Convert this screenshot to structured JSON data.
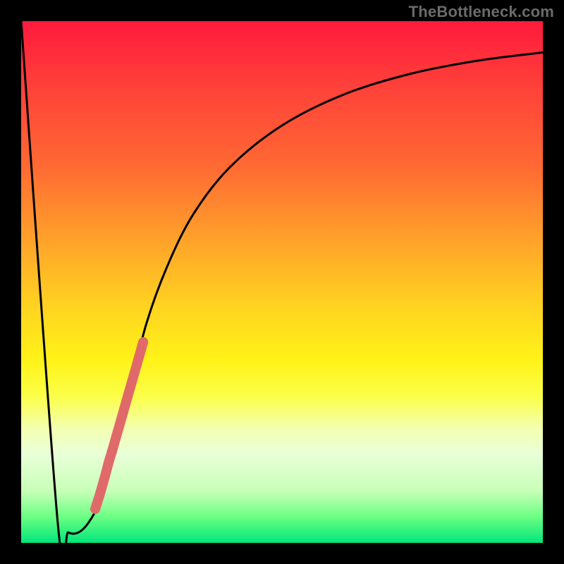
{
  "attribution": "TheBottleneck.com",
  "chart_data": {
    "type": "line",
    "title": "",
    "xlabel": "",
    "ylabel": "",
    "xlim": [
      0,
      100
    ],
    "ylim": [
      0,
      100
    ],
    "series": [
      {
        "name": "bottleneck-curve",
        "x": [
          0,
          7,
          9,
          11,
          13,
          15,
          18,
          21,
          24,
          28,
          33,
          40,
          50,
          62,
          75,
          88,
          100
        ],
        "y": [
          100,
          4,
          2,
          2,
          4,
          8,
          18,
          30,
          42,
          53,
          63,
          72,
          80,
          86,
          90,
          92.5,
          94
        ]
      }
    ],
    "markers": {
      "name": "highlighted-points",
      "color": "#e06a6a",
      "points_xy": [
        [
          14.2,
          6.5
        ],
        [
          15.0,
          9.0
        ],
        [
          16.0,
          12.5
        ],
        [
          16.8,
          15.5
        ],
        [
          17.4,
          17.5
        ],
        [
          18.4,
          21.0
        ],
        [
          19.4,
          24.5
        ],
        [
          20.4,
          28.0
        ],
        [
          21.4,
          31.5
        ],
        [
          22.4,
          35.0
        ],
        [
          23.4,
          38.5
        ]
      ]
    }
  }
}
